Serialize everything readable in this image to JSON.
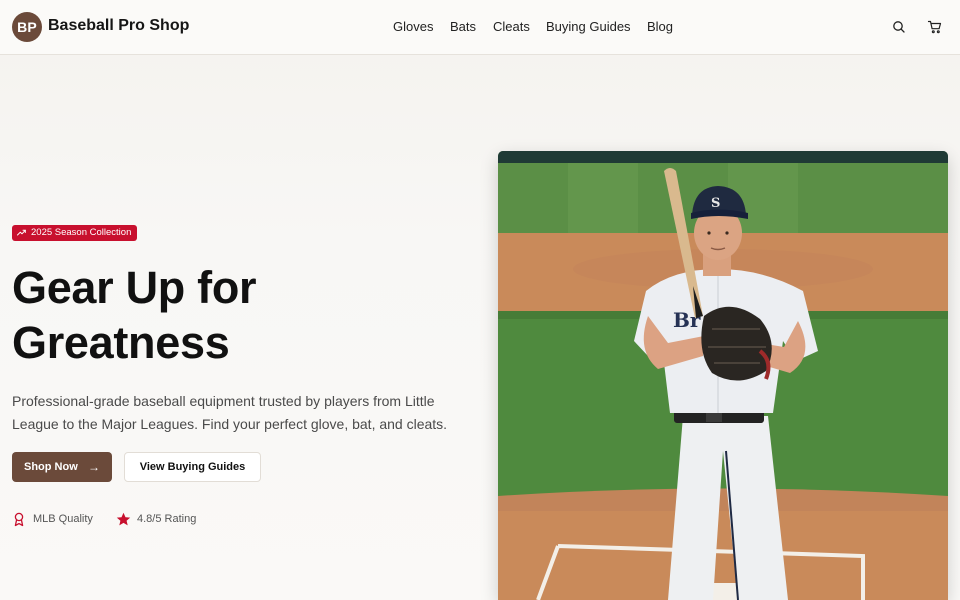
{
  "header": {
    "logo_text": "BP",
    "brand": "Baseball Pro Shop",
    "nav": [
      "Gloves",
      "Bats",
      "Cleats",
      "Buying Guides",
      "Blog"
    ],
    "icons": [
      "search-icon",
      "cart-icon"
    ]
  },
  "hero": {
    "badge": "2025 Season Collection",
    "badge_icon": "trending-up-icon",
    "headline_line1": "Gear Up for",
    "headline_line2": "Greatness",
    "subtext": "Professional-grade baseball equipment trusted by players from Little League to the Major Leagues. Find your perfect glove, bat, and cleats.",
    "primary_button": "Shop Now",
    "secondary_button": "View Buying Guides",
    "trust_items": [
      {
        "icon": "award-ribbon-icon",
        "label": "MLB Quality"
      },
      {
        "icon": "star-icon",
        "label": "4.8/5 Rating"
      }
    ],
    "image_description_icon": "hero-photo-batter"
  },
  "colors": {
    "brand_brown": "#6b4a3a",
    "accent_red": "#c8102e",
    "background": "#f6f4f1"
  }
}
